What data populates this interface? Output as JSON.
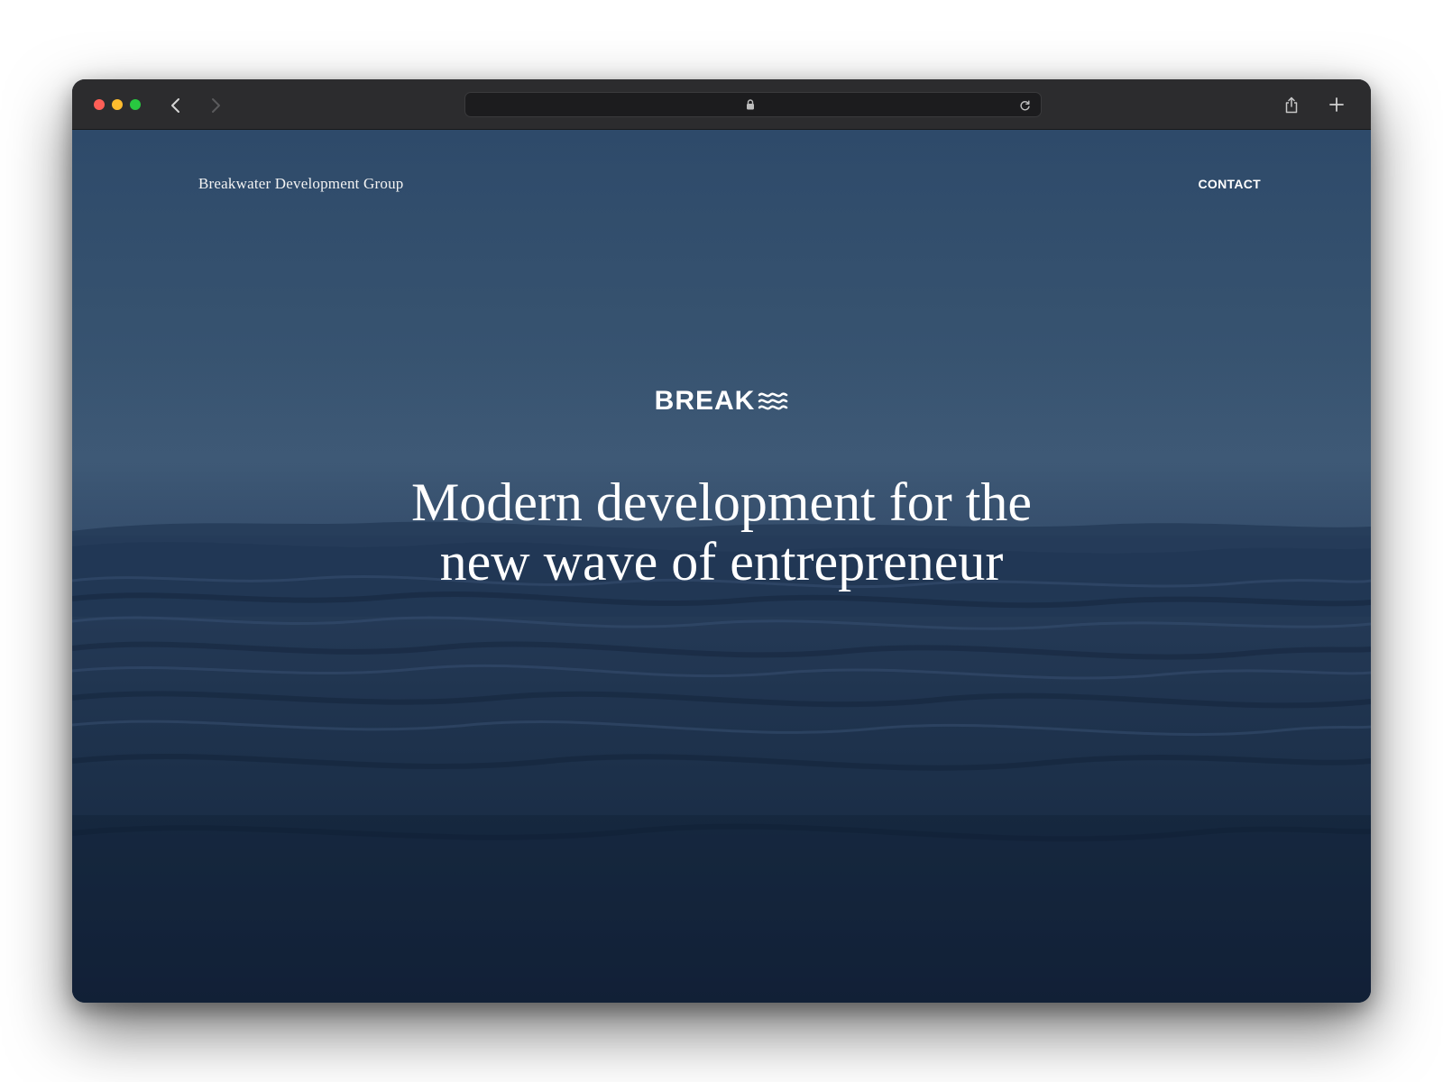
{
  "browser": {
    "url": "",
    "icons": {
      "close": "close-dot",
      "minimize": "minimize-dot",
      "maximize": "maximize-dot",
      "back": "chevron-left-icon",
      "forward": "chevron-right-icon",
      "lock": "lock-icon",
      "reload": "reload-icon",
      "share": "share-icon",
      "new_tab": "plus-icon"
    }
  },
  "header": {
    "brand": "Breakwater Development Group",
    "contact_label": "CONTACT"
  },
  "hero": {
    "logo_text": "BREAK",
    "logo_icon": "waves-icon",
    "headline_line1": "Modern development for the",
    "headline_line2": "new wave of entrepreneur"
  },
  "colors": {
    "chrome": "#2c2c2e",
    "sky": "#3b5673",
    "sea_deep": "#13223a",
    "text": "#ffffff"
  }
}
